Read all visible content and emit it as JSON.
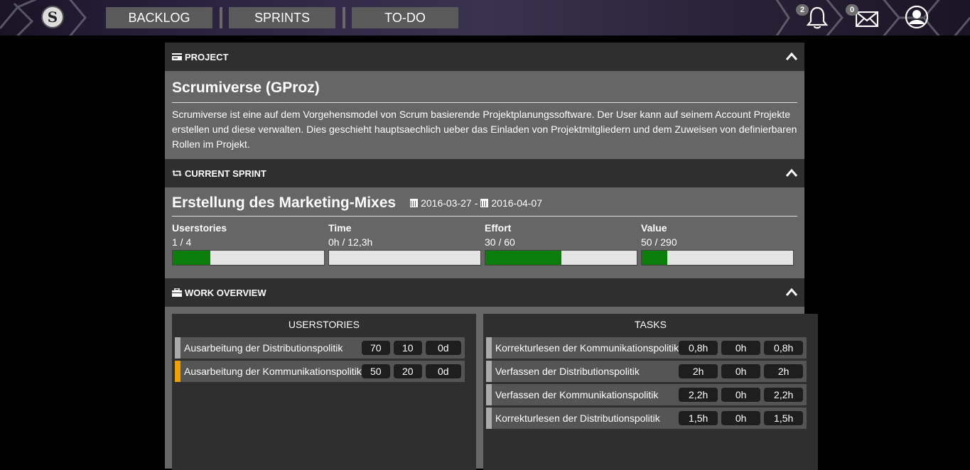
{
  "nav": {
    "logo_letter": "S",
    "buttons": [
      "BACKLOG",
      "SPRINTS",
      "TO-DO"
    ],
    "notifications_count": "2",
    "messages_count": "0"
  },
  "project": {
    "header": "PROJECT",
    "title": "Scrumiverse (GProz)",
    "description": "Scrumiverse ist eine auf dem Vorgehensmodel von Scrum basierende Projektplanungssoftware. Der User kann auf seinem Account Projekte erstellen und diese verwalten. Dies geschieht hauptsaechlich ueber das Einladen von Projektmitgliedern und dem Zuweisen von definierbaren Rollen im Projekt."
  },
  "sprint": {
    "header": "CURRENT SPRINT",
    "title": "Erstellung des Marketing-Mixes",
    "date_start": "2016-03-27",
    "date_sep": "-",
    "date_end": "2016-04-07",
    "metrics": [
      {
        "label": "Userstories",
        "value": "1 / 4",
        "progress": 0.25
      },
      {
        "label": "Time",
        "value": "0h / 12,3h",
        "progress": 0
      },
      {
        "label": "Effort",
        "value": "30 / 60",
        "progress": 0.5
      },
      {
        "label": "Value",
        "value": "50 / 290",
        "progress": 0.17
      }
    ]
  },
  "work": {
    "header": "WORK OVERVIEW",
    "userstories_title": "USERSTORIES",
    "tasks_title": "TASKS",
    "userstories": [
      {
        "name": "Ausarbeitung der Distributionspolitik",
        "a": "70",
        "b": "10",
        "c": "0d",
        "color": "#aaaaaa"
      },
      {
        "name": "Ausarbeitung der Kommunikationspolitik",
        "a": "50",
        "b": "20",
        "c": "0d",
        "color": "#f0a000"
      }
    ],
    "tasks": [
      {
        "name": "Korrekturlesen der Kommunikationspolitik",
        "a": "0,8h",
        "b": "0h",
        "c": "0,8h"
      },
      {
        "name": "Verfassen der Distributionspolitik",
        "a": "2h",
        "b": "0h",
        "c": "2h"
      },
      {
        "name": "Verfassen der Kommunikationspolitik",
        "a": "2,2h",
        "b": "0h",
        "c": "2,2h"
      },
      {
        "name": "Korrekturlesen der Distributionspolitik",
        "a": "1,5h",
        "b": "0h",
        "c": "1,5h"
      }
    ]
  }
}
